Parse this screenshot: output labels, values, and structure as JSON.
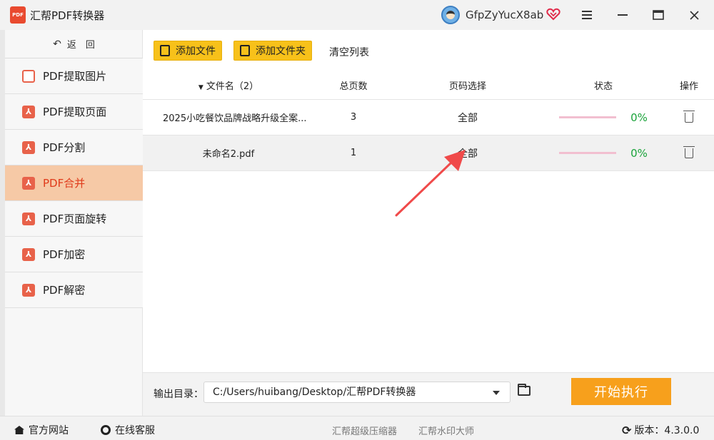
{
  "window": {
    "title": "汇帮PDF转换器",
    "logo_text": "PDF",
    "user_name": "GfpZyYucX8ab"
  },
  "sidebar": {
    "back_label": "返　回",
    "items": [
      {
        "label": "PDF提取图片",
        "icon": "image-icon",
        "active": false
      },
      {
        "label": "PDF提取页面",
        "icon": "pdf-icon",
        "active": false
      },
      {
        "label": "PDF分割",
        "icon": "pdf-icon",
        "active": false
      },
      {
        "label": "PDF合并",
        "icon": "pdf-icon",
        "active": true
      },
      {
        "label": "PDF页面旋转",
        "icon": "pdf-icon",
        "active": false
      },
      {
        "label": "PDF加密",
        "icon": "pdf-icon",
        "active": false
      },
      {
        "label": "PDF解密",
        "icon": "pdf-icon",
        "active": false
      }
    ]
  },
  "toolbar": {
    "add_file": "添加文件",
    "add_folder": "添加文件夹",
    "clear_list": "清空列表"
  },
  "table": {
    "headers": {
      "name": "文件名（2）",
      "pages": "总页数",
      "range": "页码选择",
      "status": "状态",
      "op": "操作"
    },
    "rows": [
      {
        "name": "2025小吃餐饮品牌战略升级全案...",
        "pages": "3",
        "range": "全部",
        "progress": 0,
        "percent": "0%"
      },
      {
        "name": "未命名2.pdf",
        "pages": "1",
        "range": "全部",
        "progress": 0,
        "percent": "0%"
      }
    ]
  },
  "output": {
    "label": "输出目录：",
    "path": "C:/Users/huibang/Desktop/汇帮PDF转换器",
    "start_button": "开始执行"
  },
  "footer": {
    "website": "官方网站",
    "service": "在线客服",
    "compressor": "汇帮超级压缩器",
    "watermark": "汇帮水印大师",
    "version": "版本：4.3.0.0"
  },
  "colors": {
    "accent": "#f7c11a",
    "start": "#f7a01c",
    "active_nav": "#f6c9a6",
    "active_text": "#e03a1a",
    "pdf_icon": "#e8624a",
    "success": "#1aa33a",
    "annotation_arrow": "#f04a4a"
  }
}
